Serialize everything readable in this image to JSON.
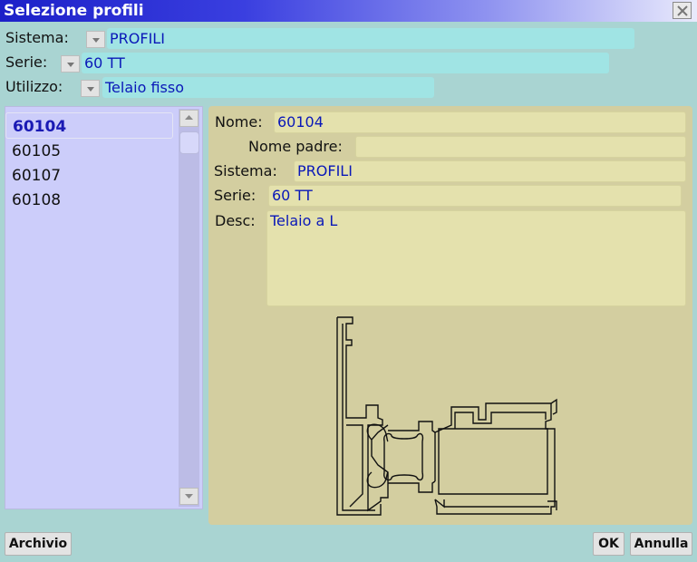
{
  "window": {
    "title": "Selezione profili"
  },
  "filters": {
    "sistema": {
      "label": "Sistema:",
      "value": "PROFILI"
    },
    "serie": {
      "label": "Serie:",
      "value": "60 TT"
    },
    "utilizzo": {
      "label": "Utilizzo:",
      "value": "Telaio fisso"
    }
  },
  "profiles": {
    "items": [
      "60104",
      "60105",
      "60107",
      "60108"
    ],
    "selected_index": 0
  },
  "details": {
    "nome": {
      "label": "Nome:",
      "value": "60104"
    },
    "nome_padre": {
      "label": "Nome padre:",
      "value": ""
    },
    "sistema": {
      "label": "Sistema:",
      "value": "PROFILI"
    },
    "serie": {
      "label": "Serie:",
      "value": "60 TT"
    },
    "desc": {
      "label": "Desc:",
      "value": "Telaio a L"
    }
  },
  "buttons": {
    "archivio": "Archivio",
    "ok": "OK",
    "annulla": "Annulla"
  },
  "colors": {
    "title_bar": "#1c20c8",
    "value_text": "#0a18b8",
    "list_bg": "#cccdfa",
    "detail_bg": "#d3cea0",
    "window_bg": "#a9d4d2"
  }
}
